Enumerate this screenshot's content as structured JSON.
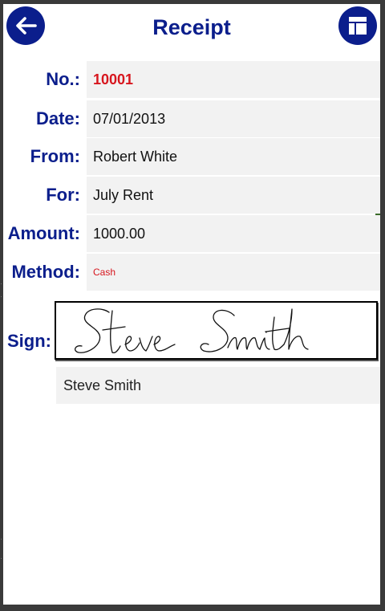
{
  "header": {
    "title": "Receipt",
    "back_icon": "arrow-left-icon",
    "menu_icon": "table-icon"
  },
  "fields": [
    {
      "label": "No.:",
      "value": "10001"
    },
    {
      "label": "Date:",
      "value": "07/01/2013"
    },
    {
      "label": "From:",
      "value": "Robert White"
    },
    {
      "label": "For:",
      "value": "July Rent"
    },
    {
      "label": "Amount:",
      "value": "1000.00"
    },
    {
      "label": "Method:",
      "value": "Cash"
    }
  ],
  "signature": {
    "label": "Sign:",
    "signed_name": "Steve Smith"
  },
  "colors": {
    "brand": "#0b1e8c",
    "accent_red": "#d7161e",
    "field_bg": "#f2f2f2"
  }
}
